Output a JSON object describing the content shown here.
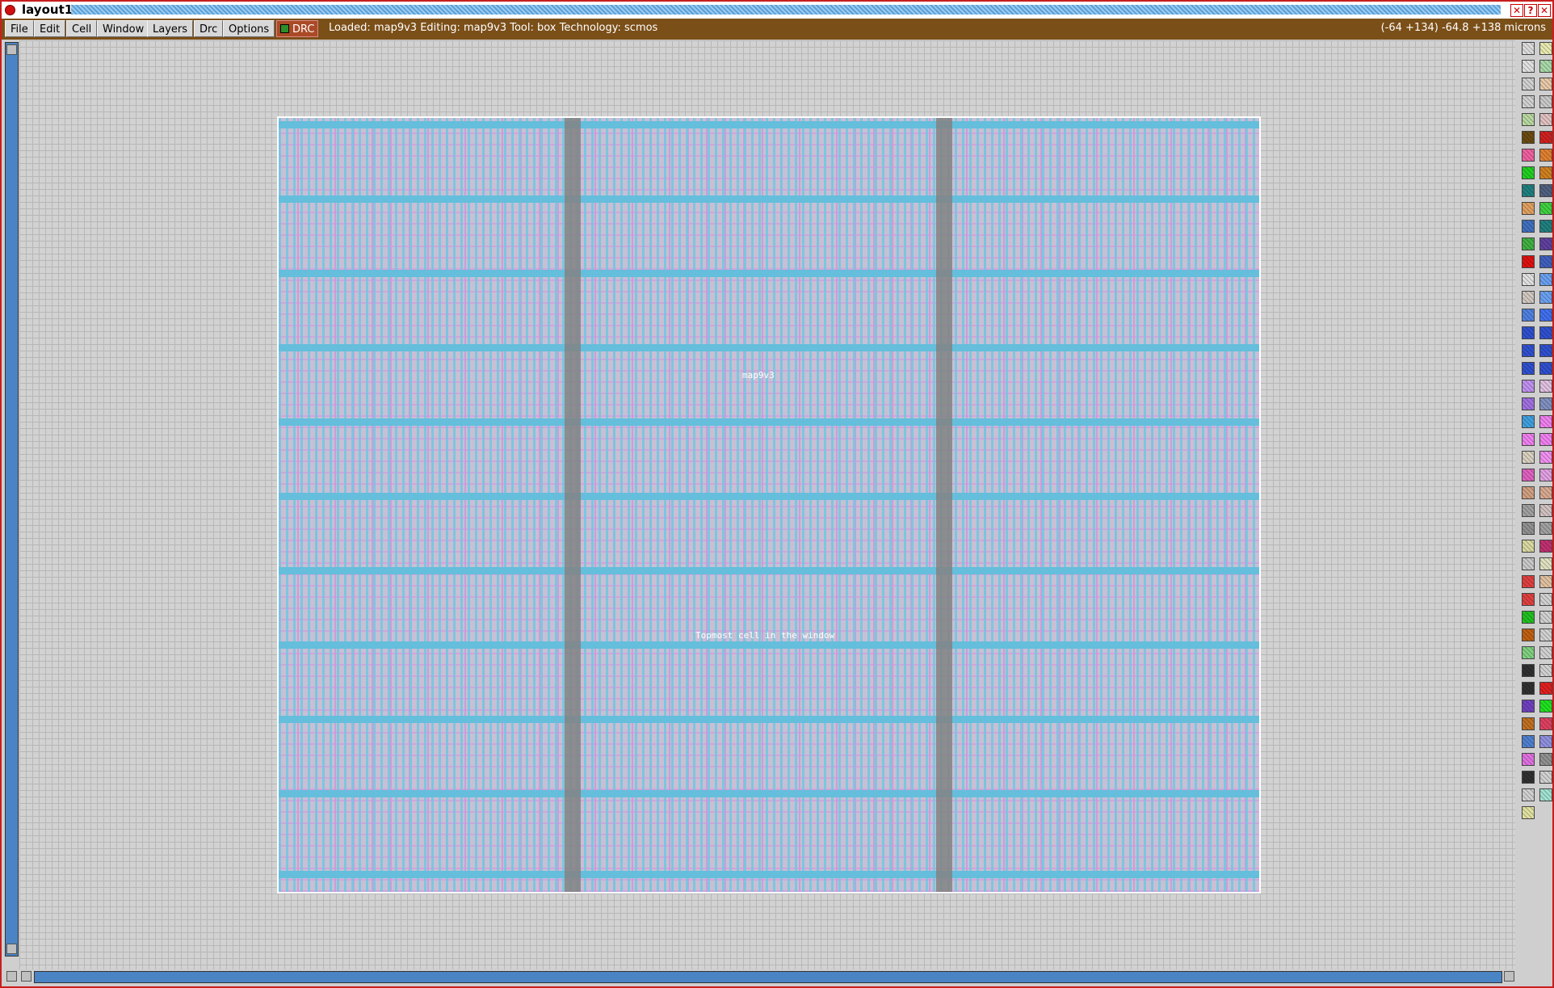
{
  "window": {
    "title": "layout1"
  },
  "menu": {
    "items": [
      "File",
      "Edit",
      "Cell",
      "Window",
      "Layers",
      "Drc",
      "Options"
    ],
    "drc_label": "DRC"
  },
  "status": {
    "text": "Loaded: map9v3 Editing: map9v3 Tool: box  Technology: scmos",
    "coords": "(-64 +134) -64.8 +138 microns"
  },
  "layout": {
    "cell_name": "map9v3",
    "caption": "Topmost cell in the window"
  },
  "colors": {
    "menubar": "#7b4f18",
    "frame": "#c81e1e",
    "metal1": "#64bedc",
    "poly": "#dc8ce1",
    "scrollbar": "#4a84c4"
  },
  "palette": {
    "swatches": [
      [
        "#dcdcdc",
        "#e8e8b0"
      ],
      [
        "#e0e0e0",
        "#a8d8a8"
      ],
      [
        "#d0d0d0",
        "#e8c8a8"
      ],
      [
        "#d0d0d0",
        "#c8c8c8"
      ],
      [
        "#b8d8a0",
        "#e0c0c0"
      ],
      [
        "#6a4a10",
        "#d02020"
      ],
      [
        "#f060a0",
        "#e08030"
      ],
      [
        "#20d020",
        "#d08020"
      ],
      [
        "#208080",
        "#506080"
      ],
      [
        "#e0a060",
        "#40d040"
      ],
      [
        "#4070c0",
        "#208080"
      ],
      [
        "#40b040",
        "#6040a0"
      ],
      [
        "#e01010",
        "#4060c0"
      ],
      [
        "#e0e0e0",
        "#6aa0f0"
      ],
      [
        "#d0c8c0",
        "#6aa0f0"
      ],
      [
        "#5080e0",
        "#4070f0"
      ],
      [
        "#3050d0",
        "#3050d0"
      ],
      [
        "#3050d0",
        "#3050d0"
      ],
      [
        "#3050d0",
        "#3050d0"
      ],
      [
        "#c090f0",
        "#e0c0e0"
      ],
      [
        "#a070e0",
        "#8090c0"
      ],
      [
        "#40a0e0",
        "#f080f0"
      ],
      [
        "#f080f0",
        "#f080f0"
      ],
      [
        "#d8d0c0",
        "#f090f0"
      ],
      [
        "#e060c0",
        "#e0a0e0"
      ],
      [
        "#d0a080",
        "#d8a890"
      ],
      [
        "#a0a0a0",
        "#d0c0c0"
      ],
      [
        "#909090",
        "#a0a0a0"
      ],
      [
        "#d8d8a0",
        "#c03070"
      ],
      [
        "#c8c8c8",
        "#e0e0c0"
      ],
      [
        "#e04040",
        "#e0c0a0"
      ],
      [
        "#e04040",
        "#d0d0d0"
      ],
      [
        "#20c020",
        "#d0d0d0"
      ],
      [
        "#c06010",
        "#d0d0d0"
      ],
      [
        "#80d080",
        "#d0d0d0"
      ],
      [
        "#303030",
        "#d0d0d0"
      ],
      [
        "#303030",
        "#e02020"
      ],
      [
        "#7040c0",
        "#20e020"
      ],
      [
        "#c07020",
        "#e04060"
      ],
      [
        "#5080d0",
        "#9090e0"
      ],
      [
        "#e070e0",
        "#909090"
      ],
      [
        "#303030",
        "#d0d0d0"
      ],
      [
        "#d0d0d0",
        "#a0e0d0"
      ],
      [
        "#e0e0a0",
        ""
      ]
    ]
  }
}
